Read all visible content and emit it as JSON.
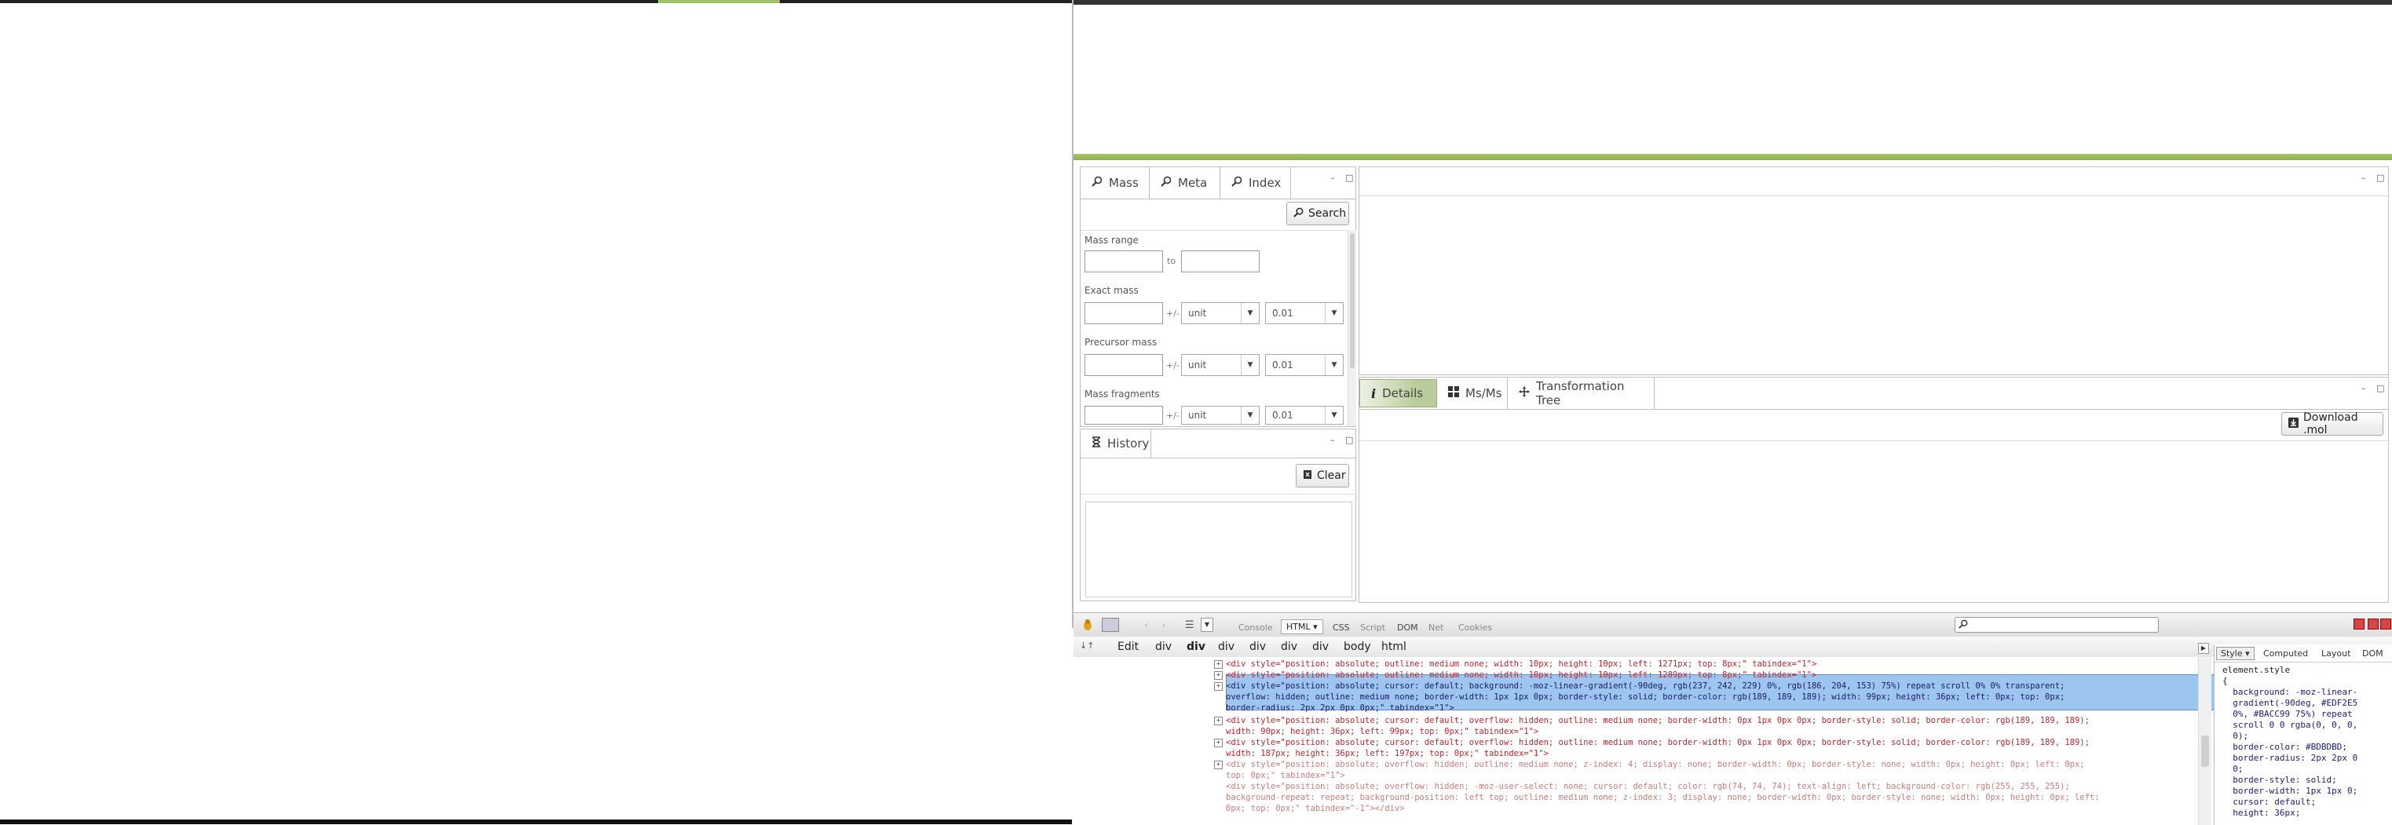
{
  "search_panel": {
    "tabs": [
      {
        "label": "Mass",
        "icon": "search-icon"
      },
      {
        "label": "Meta",
        "icon": "search-icon"
      },
      {
        "label": "Index",
        "icon": "search-icon"
      }
    ],
    "search_button": "Search",
    "mass_range_label": "Mass range",
    "to_label": "to",
    "exact_mass_label": "Exact mass",
    "precursor_mass_label": "Precursor mass",
    "mass_fragments_label": "Mass fragments",
    "plus_minus": "+/-",
    "unit_value": "unit",
    "tolerance_value": "0.01"
  },
  "history_panel": {
    "tab_label": "History",
    "clear_button": "Clear"
  },
  "detail_panel": {
    "tabs": [
      {
        "label": "Details"
      },
      {
        "label": "Ms/Ms"
      },
      {
        "label": "Transformation Tree"
      }
    ],
    "download_button": "Download .mol"
  },
  "devtools": {
    "tabs": [
      "Console",
      "HTML",
      "CSS",
      "Script",
      "DOM",
      "Net",
      "Cookies"
    ],
    "edit_label": "Edit",
    "breadcrumbs": [
      "div",
      "div",
      "div",
      "div",
      "div",
      "div",
      "body",
      "html"
    ],
    "side_tabs": [
      "Style",
      "Computed",
      "Layout",
      "DOM"
    ],
    "code_lines": [
      "<div style=\"position: absolute; outline: medium none; width: 10px; height: 10px; left: 1271px; top: 8px;\" tabindex=\"1\">",
      "<div style=\"position: absolute; outline: medium none; width: 10px; height: 10px; left: 1289px; top: 8px;\" tabindex=\"1\">",
      "<div style=\"position: absolute; cursor: default; background: -moz-linear-gradient(-90deg, rgb(237, 242, 229) 0%, rgb(186, 204, 153) 75%) repeat scroll 0% 0% transparent;",
      "overflow: hidden; outline: medium none; border-width: 1px 1px 0px; border-style: solid; border-color: rgb(189, 189, 189); width: 99px; height: 36px; left: 0px; top: 0px;",
      "border-radius: 2px 2px 0px 0px;\" tabindex=\"1\">",
      "<div style=\"position: absolute; cursor: default; overflow: hidden; outline: medium none; border-width: 0px 1px 0px 0px; border-style: solid; border-color: rgb(189, 189, 189);",
      "width: 90px; height: 36px; left: 99px; top: 0px;\" tabindex=\"1\">",
      "<div style=\"position: absolute; cursor: default; overflow: hidden; outline: medium none; border-width: 0px 1px 0px 0px; border-style: solid; border-color: rgb(189, 189, 189);",
      "width: 187px; height: 36px; left: 197px; top: 0px;\" tabindex=\"1\">",
      "<div style=\"position: absolute; overflow: hidden; outline: medium none; z-index: 4; display: none; border-width: 0px; border-style: none; width: 0px; height: 0px; left: 0px;",
      "top: 0px;\" tabindex=\"1\">",
      "<div style=\"position: absolute; overflow: hidden; -moz-user-select: none; cursor: default; color: rgb(74, 74, 74); text-align: left; background-color: rgb(255, 255, 255);",
      "background-repeat: repeat; background-position: left top; outline: medium none; z-index: 3; display: none; border-width: 0px; border-style: none; width: 0px; height: 0px; left:",
      "0px; top: 0px;\" tabindex=\"-1\"></div>"
    ],
    "style_lines": [
      "element.style",
      "{",
      "  background: -moz-linear-",
      "  gradient(-90deg, #EDF2E5",
      "  0%, #BACC99 75%) repeat",
      "  scroll 0 0 rgba(0, 0, 0,",
      "  0);",
      "  border-color: #BDBDBD;",
      "  border-radius: 2px 2px 0",
      "  0;",
      "  border-style: solid;",
      "  border-width: 1px 1px 0;",
      "  cursor: default;",
      "  height: 36px;"
    ]
  }
}
